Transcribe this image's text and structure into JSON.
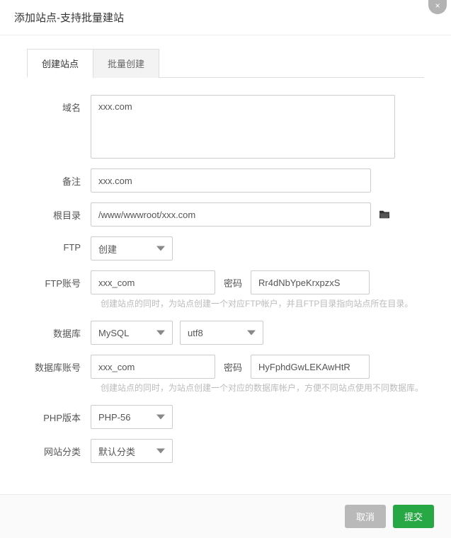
{
  "header": {
    "title": "添加站点-支持批量建站"
  },
  "tabs": {
    "create": "创建站点",
    "batch": "批量创建"
  },
  "labels": {
    "domain": "域名",
    "remark": "备注",
    "root": "根目录",
    "ftp": "FTP",
    "ftp_account": "FTP账号",
    "ftp_password": "密码",
    "database": "数据库",
    "db_account": "数据库账号",
    "db_password": "密码",
    "php_version": "PHP版本",
    "site_category": "网站分类"
  },
  "values": {
    "domain": "xxx.com",
    "remark": "xxx.com",
    "root": "/www/wwwroot/xxx.com",
    "ftp_select": "创建",
    "ftp_user": "xxx_com",
    "ftp_pass": "Rr4dNbYpeKrxpzxS",
    "db_type": "MySQL",
    "db_charset": "utf8",
    "db_user": "xxx_com",
    "db_pass": "HyFphdGwLEKAwHtR",
    "php_version": "PHP-56",
    "site_category": "默认分类"
  },
  "hints": {
    "ftp": "创建站点的同时，为站点创建一个对应FTP帐户，并且FTP目录指向站点所在目录。",
    "db": "创建站点的同时，为站点创建一个对应的数据库帐户，方便不同站点使用不同数据库。"
  },
  "buttons": {
    "cancel": "取消",
    "submit": "提交"
  }
}
